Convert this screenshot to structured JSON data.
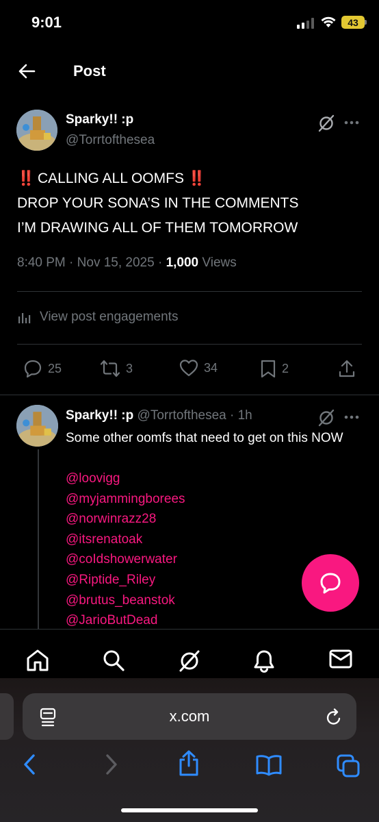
{
  "status_bar": {
    "time": "9:01",
    "battery": "43"
  },
  "header": {
    "title": "Post"
  },
  "post": {
    "author_name": "Sparky!! :p",
    "author_handle": "@Torrtofthesea",
    "emoji": "‼️",
    "line1": "CALLING ALL OOMFS",
    "line2": "DROP YOUR SONA’S IN THE COMMENTS",
    "line3": "I’M DRAWING ALL OF THEM TOMORROW",
    "time": "8:40 PM",
    "date": "Nov 15, 2025",
    "views_count": "1,000",
    "views_label": "Views",
    "separator": " · ",
    "engagements_label": "View post engagements",
    "replies": "25",
    "reposts": "3",
    "likes": "34",
    "bookmarks": "2"
  },
  "reply": {
    "author_name": "Sparky!! :p",
    "author_handle": "@Torrtofthesea",
    "time_ago": "1h",
    "text": "Some other oomfs that need to get on this NOW",
    "mentions": [
      "@loovigg",
      "@myjammingborees",
      "@norwinrazz28",
      "@itsrenatoak",
      "@coIdshowerwater",
      "@Riptide_Riley",
      "@brutus_beanstok",
      "@JarioButDead"
    ]
  },
  "browser": {
    "url": "x.com"
  },
  "colors": {
    "background": "#000000",
    "text_primary": "#e7e9ea",
    "text_secondary": "#71767b",
    "accent_pink": "#f91880",
    "divider": "#2f3336",
    "emoji_red": "#e3242b",
    "safari_blue": "#2f8cff",
    "battery_yellow": "#e3c832"
  },
  "icons": {
    "back": "arrow-left-icon",
    "grok": "grok-icon",
    "more": "more-dots-icon",
    "engagements": "bar-chart-icon",
    "reply": "comment-icon",
    "repost": "repost-icon",
    "like": "heart-icon",
    "bookmark": "bookmark-icon",
    "share": "share-icon",
    "fab": "compose-reply-icon",
    "nav": [
      "home-icon",
      "search-icon",
      "grok-icon",
      "bell-icon",
      "mail-icon"
    ],
    "safari": [
      "back-chevron-icon",
      "forward-chevron-icon",
      "share-icon",
      "bookmarks-icon",
      "tabs-icon"
    ]
  }
}
